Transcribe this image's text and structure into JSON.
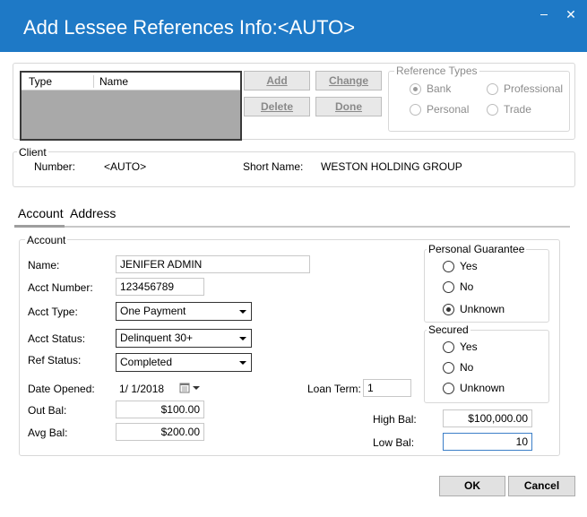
{
  "window": {
    "title": "Add Lessee References Info:<AUTO>",
    "close_glyph": "✕"
  },
  "references": {
    "columns": [
      "Type",
      "Name"
    ],
    "buttons": {
      "add": "Add",
      "change": "Change",
      "delete": "Delete",
      "done": "Done"
    }
  },
  "reference_types": {
    "legend": "Reference Types",
    "options": [
      {
        "label": "Bank",
        "checked": true
      },
      {
        "label": "Professional",
        "checked": false
      },
      {
        "label": "Personal",
        "checked": false
      },
      {
        "label": "Trade",
        "checked": false
      }
    ]
  },
  "client": {
    "legend": "Client",
    "number_label": "Number:",
    "number_value": "<AUTO>",
    "short_name_label": "Short Name:",
    "short_name_value": "WESTON HOLDING GROUP"
  },
  "tabs": [
    "Account",
    "Address"
  ],
  "account": {
    "legend": "Account",
    "name_label": "Name:",
    "name_value": "JENIFER ADMIN",
    "acct_number_label": "Acct Number:",
    "acct_number_value": "123456789",
    "acct_type_label": "Acct Type:",
    "acct_type_value": "One Payment",
    "acct_status_label": "Acct Status:",
    "acct_status_value": "Delinquent 30+",
    "ref_status_label": "Ref Status:",
    "ref_status_value": "Completed",
    "date_opened_label": "Date Opened:",
    "date_opened_value": "1/  1/2018",
    "loan_term_label": "Loan Term:",
    "loan_term_value": "1",
    "out_bal_label": "Out Bal:",
    "out_bal_value": "$100.00",
    "avg_bal_label": "Avg Bal:",
    "avg_bal_value": "$200.00",
    "high_bal_label": "High Bal:",
    "high_bal_value": "$100,000.00",
    "low_bal_label": "Low Bal:",
    "low_bal_value": "10"
  },
  "personal_guarantee": {
    "legend": "Personal Guarantee",
    "options": [
      {
        "label": "Yes",
        "checked": false
      },
      {
        "label": "No",
        "checked": false
      },
      {
        "label": "Unknown",
        "checked": true
      }
    ]
  },
  "secured": {
    "legend": "Secured",
    "options": [
      {
        "label": "Yes",
        "checked": false
      },
      {
        "label": "No",
        "checked": false
      },
      {
        "label": "Unknown",
        "checked": false
      }
    ]
  },
  "footer": {
    "ok": "OK",
    "cancel": "Cancel"
  },
  "icons": {
    "calendar": "calendar-icon",
    "dropdown": "chevron-down-icon",
    "minimize": "minimize-icon",
    "close": "close-icon"
  },
  "colors": {
    "titlebar": "#1e79c6",
    "list_background": "#a9a9a9",
    "focus_border": "#3c7fc8"
  }
}
